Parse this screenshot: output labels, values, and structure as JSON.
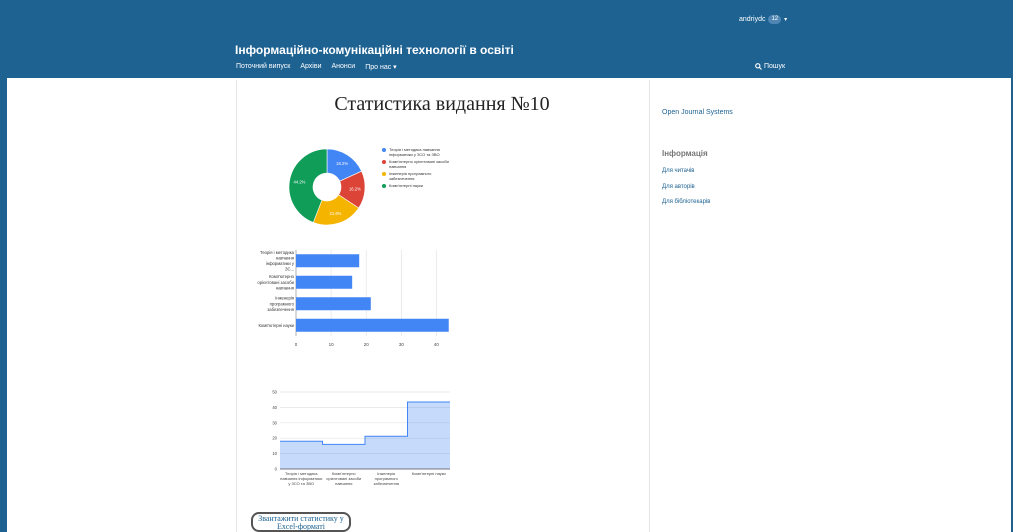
{
  "header": {
    "username": "andriydc",
    "badge": "12",
    "site_title": "Інформаційно-комунікаційні технології в освіті",
    "nav": [
      "Поточний випуск",
      "Архіви",
      "Анонси",
      "Про нас ▾"
    ],
    "search_label": "Пошук"
  },
  "page": {
    "title": "Статистика видання №10",
    "excel_button": "Звантажити статистику у Excel-форматі"
  },
  "sidebar": {
    "ojs_link": "Open Journal Systems",
    "info_heading": "Інформація",
    "links": [
      "Для читачів",
      "Для авторів",
      "Для бібліотекарів"
    ]
  },
  "colors": {
    "header_bg": "#1e6292",
    "blue": "#4285f4",
    "red": "#db4437",
    "yellow": "#f4b400",
    "green": "#0f9d58"
  },
  "chart_data": [
    {
      "type": "pie",
      "categories": [
        "Теорія і методика навчання інформатики у ЗСО та ЗВО",
        "Комп'ютерно орієнтовані засоби навчання",
        "Інженерія програмного забезпечення",
        "Комп'ютерні науки"
      ],
      "values": [
        18.2,
        16.2,
        21.6,
        44.2
      ],
      "labels": [
        "18.2%",
        "16.2%",
        "21.6%",
        "44.2%"
      ]
    },
    {
      "type": "bar",
      "orientation": "horizontal",
      "categories": [
        "Теорія і методика навчання інформатики у ЗС...",
        "Комп'ютерно орієнтовані засоби навчання",
        "Інженерія програмного забезпечення",
        "Комп'ютерні науки"
      ],
      "values": [
        18,
        16,
        21.3,
        43.5
      ],
      "xlim": [
        0,
        45
      ],
      "xticks": [
        "0",
        "10",
        "20",
        "30",
        "40"
      ]
    },
    {
      "type": "area",
      "categories": [
        "Теорія і методика навчання інформатики у ЗСО та ЗВО",
        "Комп'ютерно орієнтовані засоби навчання",
        "Інженерія програмного забезпечення",
        "Комп'ютерні науки"
      ],
      "values": [
        18,
        16,
        21.3,
        43.5
      ],
      "ylim": [
        0,
        50
      ],
      "yticks": [
        "0",
        "10",
        "20",
        "30",
        "40",
        "50"
      ]
    }
  ]
}
